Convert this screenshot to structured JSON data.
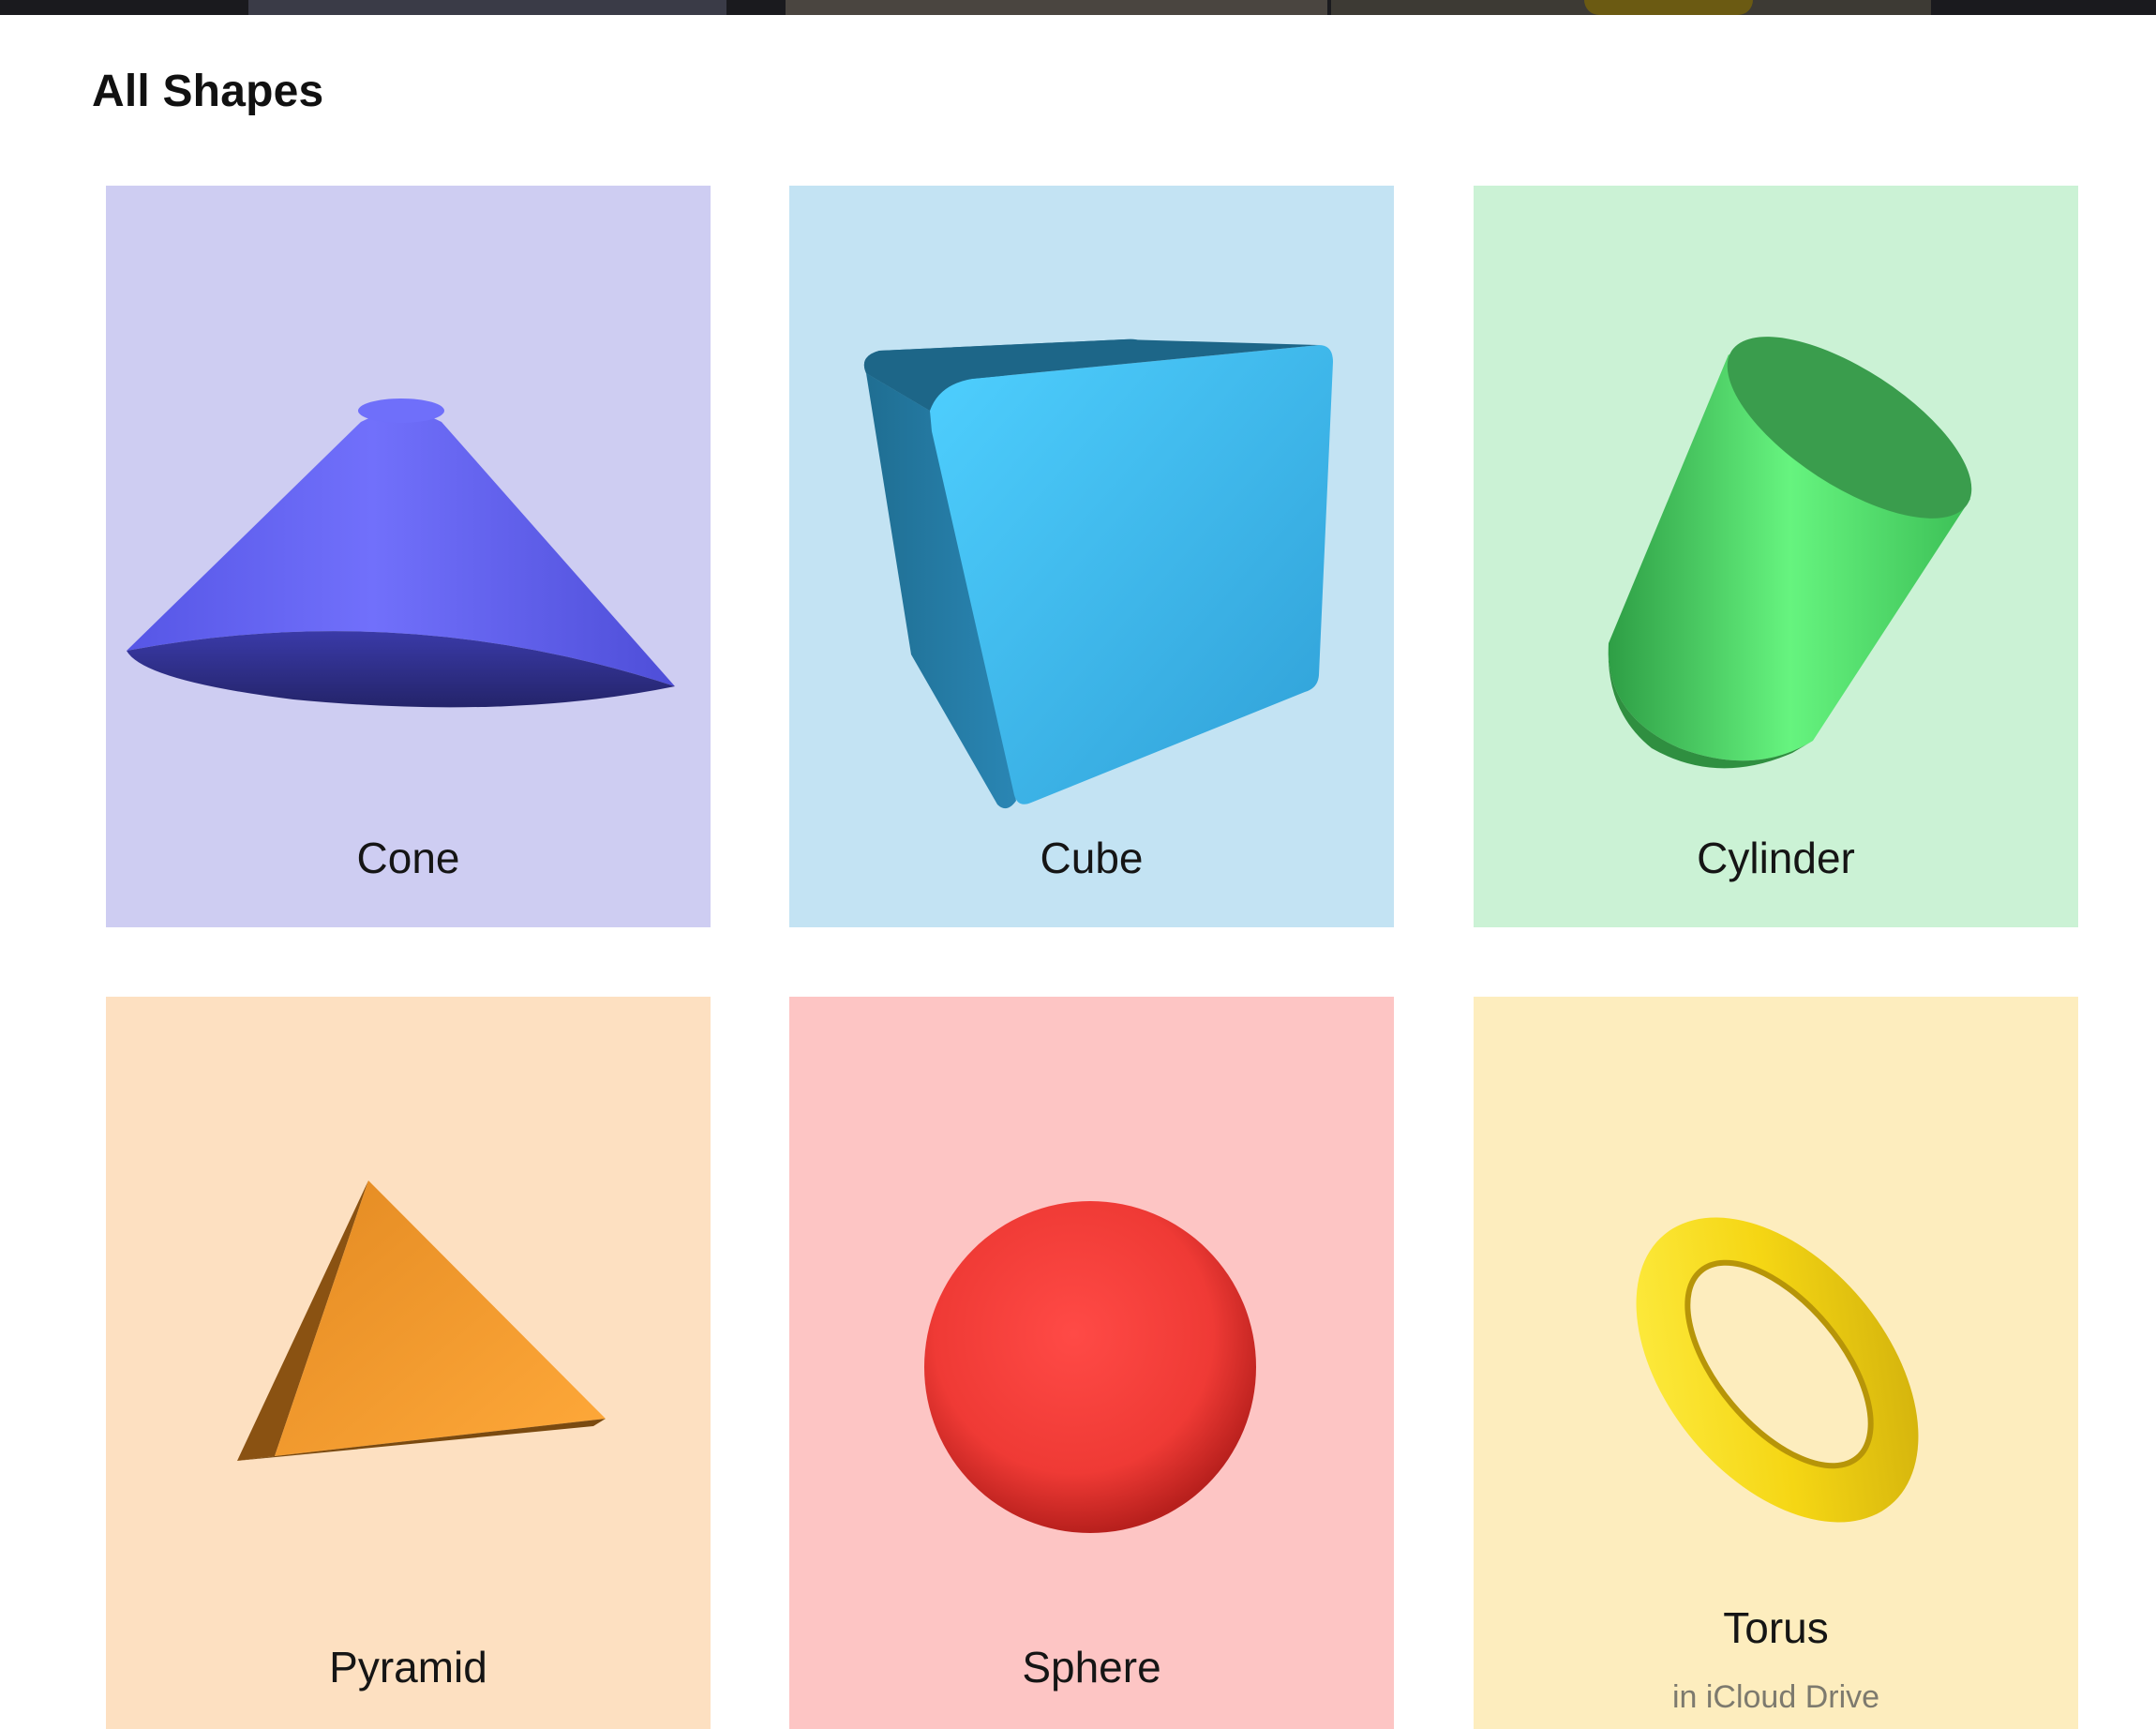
{
  "section": {
    "title": "All Shapes"
  },
  "shapes": [
    {
      "label": "Cone",
      "icon": "cone-shape",
      "background": "#cecdf2",
      "color": "#6b6cf8"
    },
    {
      "label": "Cube",
      "icon": "cube-shape",
      "background": "#c3e3f3",
      "color": "#45b8ec"
    },
    {
      "label": "Cylinder",
      "icon": "cylinder-shape",
      "background": "#cbf2d5",
      "color": "#5fe074"
    },
    {
      "label": "Pyramid",
      "icon": "pyramid-shape",
      "background": "#fde0c1",
      "color": "#f8a333"
    },
    {
      "label": "Sphere",
      "icon": "sphere-shape",
      "background": "#fdc5c4",
      "color": "#f4413d"
    },
    {
      "label": "Torus",
      "sublabel": "in iCloud Drive",
      "icon": "torus-shape",
      "background": "#fdedbe",
      "color": "#f7d416"
    }
  ]
}
